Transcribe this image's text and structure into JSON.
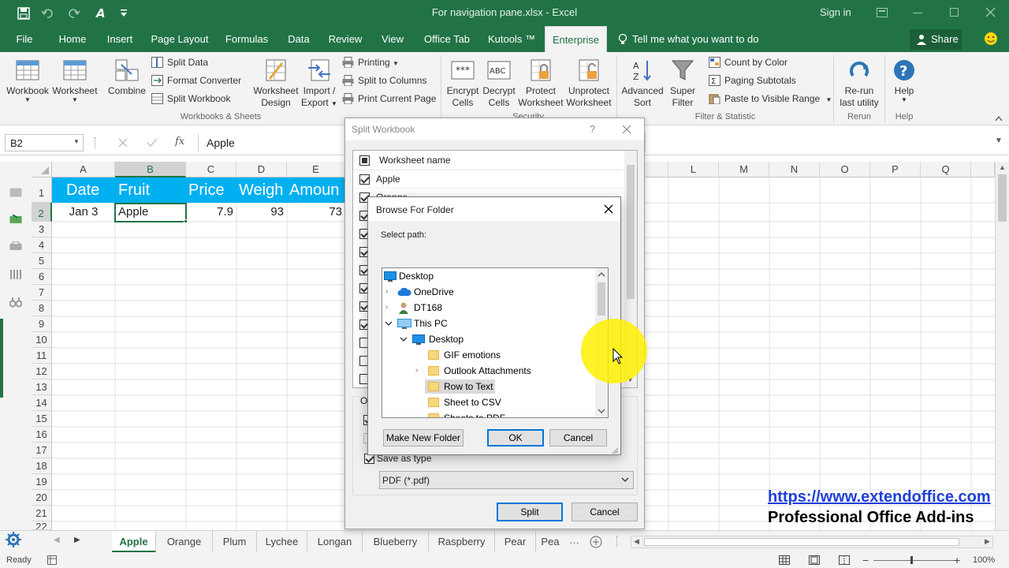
{
  "window": {
    "title": "For navigation pane.xlsx  -  Excel",
    "sign_in": "Sign in"
  },
  "ribbon_tabs": [
    "File",
    "Home",
    "Insert",
    "Page Layout",
    "Formulas",
    "Data",
    "Review",
    "View",
    "Office Tab",
    "Kutools ™",
    "Enterprise"
  ],
  "tell_me": "Tell me what you want to do",
  "share": "Share",
  "ribbon": {
    "workbook": "Workbook",
    "worksheet": "Worksheet",
    "combine": "Combine",
    "split_data": "Split Data",
    "format_converter": "Format Converter",
    "split_workbook": "Split Workbook",
    "worksheet_design_1": "Worksheet",
    "worksheet_design_2": "Design",
    "import_export_1": "Import /",
    "import_export_2": "Export",
    "printing": "Printing",
    "split_to_columns": "Split to Columns",
    "print_current_page": "Print Current Page",
    "group_workbooks": "Workbooks & Sheets",
    "encrypt_1": "Encrypt",
    "encrypt_2": "Cells",
    "decrypt_1": "Decrypt",
    "decrypt_2": "Cells",
    "protect_1": "Protect",
    "protect_2": "Worksheet",
    "unprotect_1": "Unprotect",
    "unprotect_2": "Worksheet",
    "group_security": "Security",
    "advanced_sort_1": "Advanced",
    "advanced_sort_2": "Sort",
    "super_filter_1": "Super",
    "super_filter_2": "Filter",
    "count_by_color": "Count by Color",
    "paging_subtotals": "Paging Subtotals",
    "paste_visible": "Paste to Visible Range",
    "group_filter": "Filter & Statistic",
    "rerun_1": "Re-run",
    "rerun_2": "last utility",
    "group_rerun": "Rerun",
    "help": "Help",
    "group_help": "Help",
    "abc_icon": "ABC",
    "stars_icon": "***"
  },
  "formula_bar": {
    "name_box": "B2",
    "fx": "fx",
    "content": "Apple"
  },
  "columns": [
    "A",
    "B",
    "C",
    "D",
    "E",
    "L",
    "M",
    "N",
    "O",
    "P",
    "Q"
  ],
  "rows": [
    "1",
    "2",
    "3",
    "4",
    "5",
    "6",
    "7",
    "8",
    "9",
    "10",
    "11",
    "12",
    "13",
    "14",
    "15",
    "16",
    "17",
    "18",
    "19",
    "20",
    "21",
    "22"
  ],
  "table_headers": [
    "Date",
    "Fruit",
    "Price",
    "Weigh",
    "Amoun"
  ],
  "table_row": [
    "Jan 3",
    "Apple",
    "7.9",
    "93",
    "73"
  ],
  "sheet_tabs": [
    "Apple",
    "Orange",
    "Plum",
    "Lychee",
    "Longan",
    "Blueberry",
    "Raspberry",
    "Pear",
    "Pea"
  ],
  "status": {
    "ready": "Ready",
    "zoom": "100%"
  },
  "split_dialog": {
    "title": "Split Workbook",
    "help": "?",
    "column_header": "Worksheet name",
    "sheets": [
      "Apple",
      "Orange"
    ],
    "options_label": "Op",
    "save_as_type": "Save as type",
    "file_type": "PDF (*.pdf)",
    "split_button": "Split",
    "cancel_button": "Cancel"
  },
  "browse_dialog": {
    "title": "Browse For Folder",
    "select_path": "Select path:",
    "tree": [
      "Desktop",
      "OneDrive",
      "DT168",
      "This PC",
      "Desktop",
      "GIF emotions",
      "Outlook Attachments",
      "Row to Text",
      "Sheet to CSV",
      "Sheets to PDF"
    ],
    "make_new_folder": "Make New Folder",
    "ok": "OK",
    "cancel": "Cancel"
  },
  "watermark": {
    "url": "https://www.extendoffice.com",
    "tagline": "Professional Office Add-ins"
  }
}
